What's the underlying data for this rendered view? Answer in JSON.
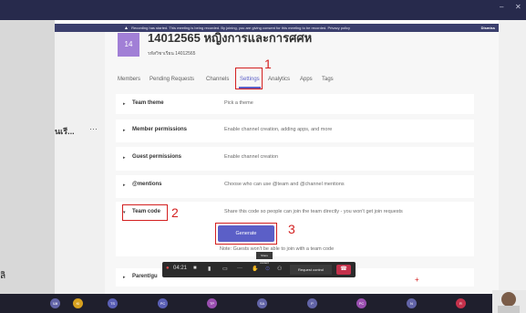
{
  "window": {
    "minimize_glyph": "–",
    "close_glyph": "✕"
  },
  "recording_banner": {
    "text": "Recording has started. This meeting is being recorded. By joining, you are giving consent for this meeting to be recorded. Privacy policy",
    "dismiss_label": "Dismiss",
    "icon": "warning-icon"
  },
  "left_panel": {
    "truncated_team": "นเรี...",
    "more": "···"
  },
  "team": {
    "avatar_initials": "14",
    "title": "14012565 หญิงการและการศศห",
    "code_line": "รหัสวิชาเรียน 14012565"
  },
  "tabs": [
    {
      "label": "Members"
    },
    {
      "label": "Pending Requests"
    },
    {
      "label": "Channels"
    },
    {
      "label": "Settings",
      "active": true
    },
    {
      "label": "Analytics"
    },
    {
      "label": "Apps"
    },
    {
      "label": "Tags"
    }
  ],
  "settings": [
    {
      "label": "Team theme",
      "desc": "Pick a theme"
    },
    {
      "label": "Member permissions",
      "desc": "Enable channel creation, adding apps, and more"
    },
    {
      "label": "Guest permissions",
      "desc": "Enable channel creation"
    },
    {
      "label": "@mentions",
      "desc": "Choose who can use @team and @channel mentions"
    },
    {
      "label": "Team code",
      "desc": "Share this code so people can join the team directly - you won't get join requests",
      "expanded": true
    },
    {
      "label": "Parent/gu"
    }
  ],
  "team_code": {
    "generate_label": "Generate",
    "note": "Note: Guests won't be able to join with a team code"
  },
  "annotations": {
    "n1": "1",
    "n2": "2",
    "n3": "3",
    "color": "#d32020"
  },
  "meeting_toolbar": {
    "timer": "04:21",
    "tooltip": "Share content",
    "request_control": "Request control",
    "hangup_icon": "phone-hangup-icon"
  },
  "participants": [
    {
      "initials": "นพ",
      "color": "#6264a7"
    },
    {
      "initials": "KI",
      "color": "#d6a01f"
    },
    {
      "initials": "TS",
      "color": "#5a5fb5"
    },
    {
      "initials": "PC",
      "color": "#5a5fb5"
    },
    {
      "initials": "TP",
      "color": "#9a4fb0"
    },
    {
      "initials": "SA",
      "color": "#6264a7"
    },
    {
      "initials": "P",
      "color": "#6264a7"
    },
    {
      "initials": "PC",
      "color": "#9a4fb0"
    },
    {
      "initials": "N",
      "color": "#6264a7"
    },
    {
      "initials": "R",
      "color": "#c4314b"
    }
  ],
  "left_glyph": "ลิ"
}
